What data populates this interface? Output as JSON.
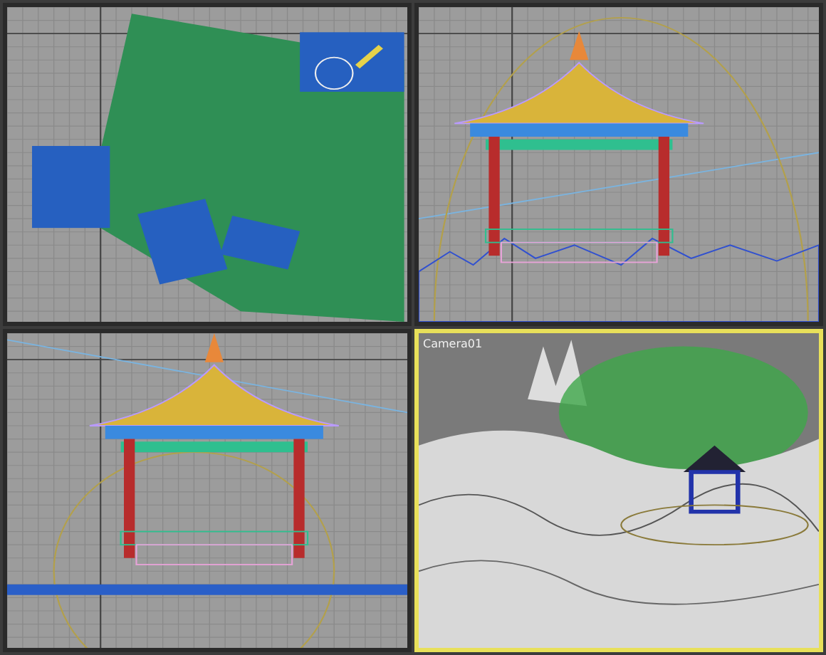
{
  "viewports": [
    {
      "kind": "top",
      "selected": false
    },
    {
      "kind": "front",
      "selected": false
    },
    {
      "kind": "left",
      "selected": false
    },
    {
      "kind": "camera",
      "selected": true,
      "label": "Camera01"
    }
  ]
}
